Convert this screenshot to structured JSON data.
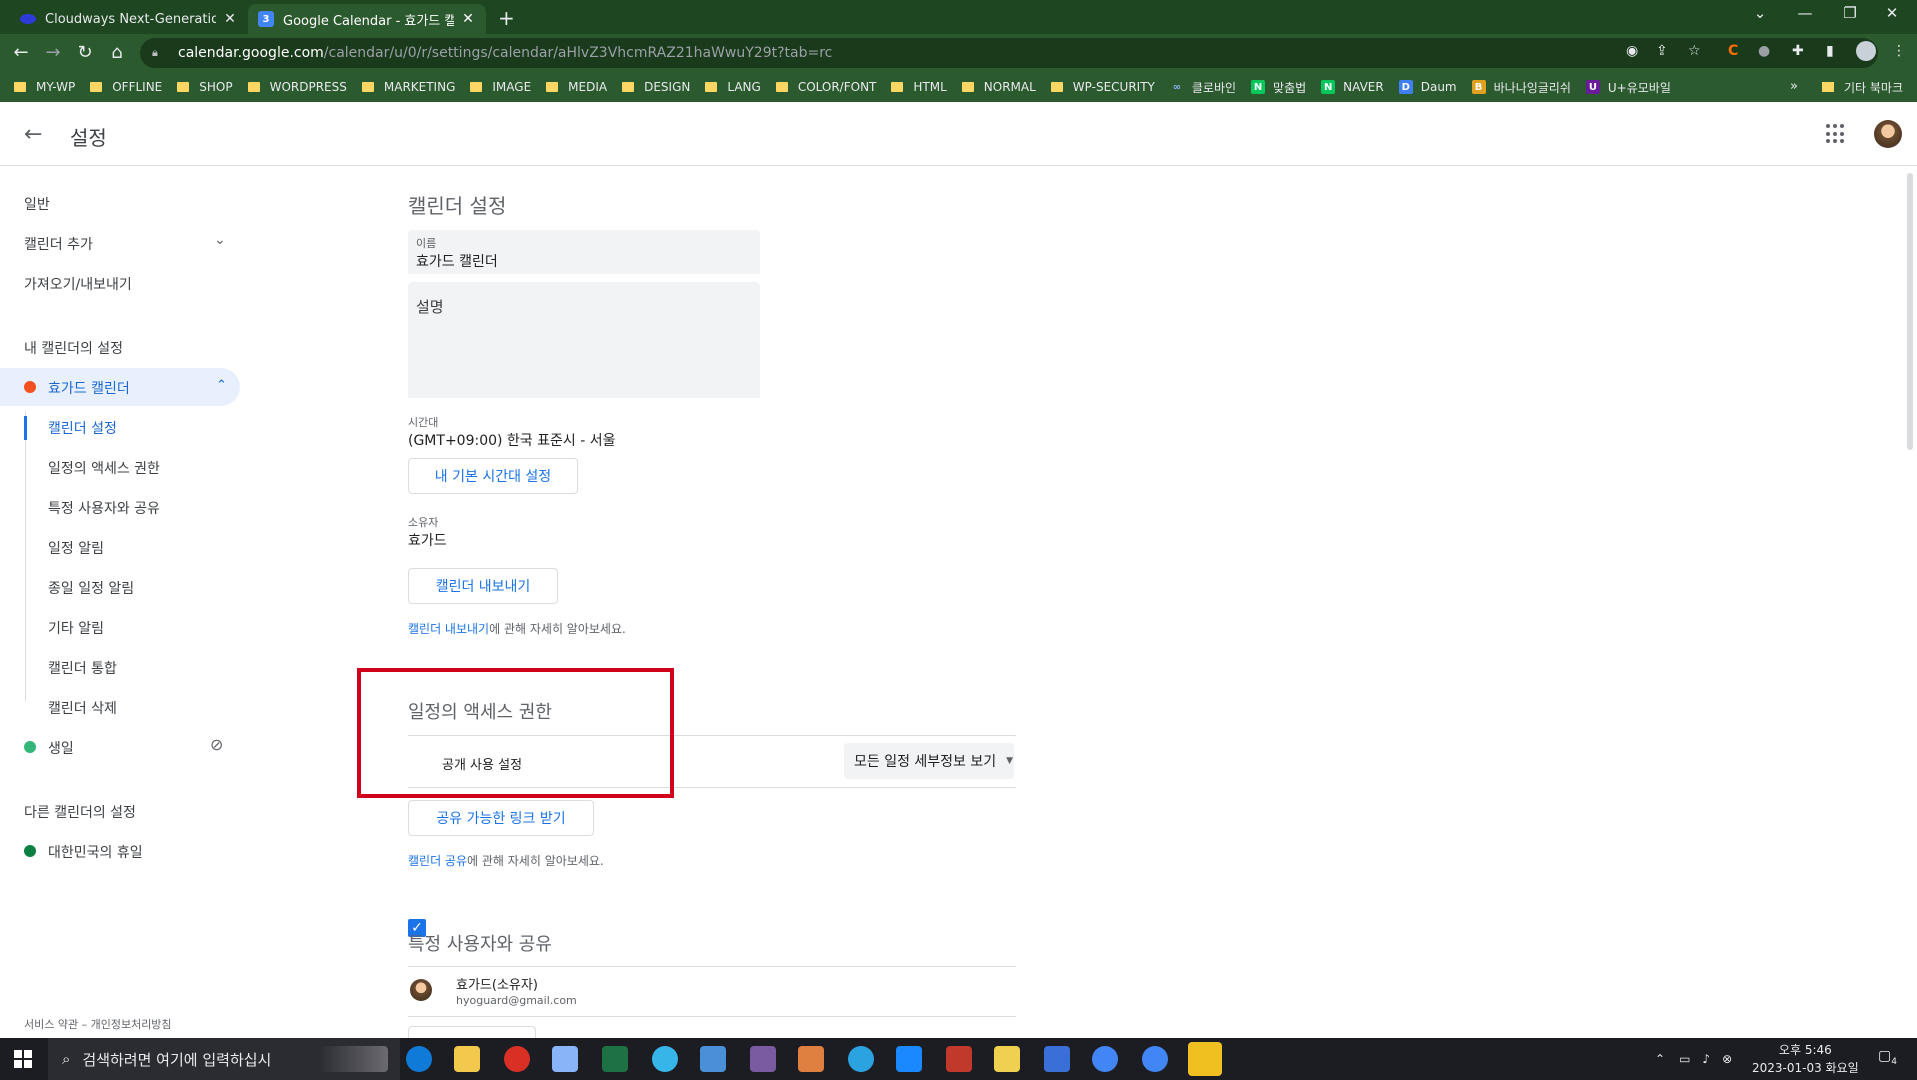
{
  "browser": {
    "tabs": [
      {
        "label": "Cloudways Next-Generation Clo",
        "favicon_color": "#2d3bd8"
      },
      {
        "label": "Google Calendar - 효가드 캘린더",
        "favicon_color": "#4285f4",
        "favicon_text": "3"
      }
    ],
    "url_host": "calendar.google.com",
    "url_path": "/calendar/u/0/r/settings/calendar/aHlvZ3VhcmRAZ21haWwuY29t?tab=rc",
    "bookmarks": [
      {
        "label": "MY-WP",
        "type": "folder"
      },
      {
        "label": "OFFLINE",
        "type": "folder"
      },
      {
        "label": "SHOP",
        "type": "folder"
      },
      {
        "label": "WORDPRESS",
        "type": "folder"
      },
      {
        "label": "MARKETING",
        "type": "folder"
      },
      {
        "label": "IMAGE",
        "type": "folder"
      },
      {
        "label": "MEDIA",
        "type": "folder"
      },
      {
        "label": "DESIGN",
        "type": "folder"
      },
      {
        "label": "LANG",
        "type": "folder"
      },
      {
        "label": "COLOR/FONT",
        "type": "folder"
      },
      {
        "label": "HTML",
        "type": "folder"
      },
      {
        "label": "NORMAL",
        "type": "folder"
      },
      {
        "label": "WP-SECURITY",
        "type": "folder"
      },
      {
        "label": "클로바인",
        "type": "site",
        "icon_text": "∞",
        "color": "#2c5a2f"
      },
      {
        "label": "맞춤법",
        "type": "site",
        "icon_text": "N",
        "color": "#03c75a"
      },
      {
        "label": "NAVER",
        "type": "site",
        "icon_text": "N",
        "color": "#03c75a"
      },
      {
        "label": "Daum",
        "type": "site",
        "icon_text": "D",
        "color": "#3f7ef3"
      },
      {
        "label": "바나나잉글리쉬",
        "type": "site",
        "icon_text": "B",
        "color": "#e0a020"
      },
      {
        "label": "U+유모바일",
        "type": "site",
        "icon_text": "U",
        "color": "#6a1b9a"
      }
    ],
    "bookmarks_more": "»",
    "other_bookmarks": "기타 북마크"
  },
  "header": {
    "title": "설정"
  },
  "sidebar": {
    "general": "일반",
    "add_calendar": "캘린더 추가",
    "import_export": "가져오기/내보내기",
    "my_calendars_heading": "내 캘린더의 설정",
    "active_calendar": "효가드 캘린더",
    "active_calendar_color": "#f4511e",
    "sub_items": [
      "캘린더 설정",
      "일정의 액세스 권한",
      "특정 사용자와 공유",
      "일정 알림",
      "종일 일정 알림",
      "기타 알림",
      "캘린더 통합",
      "캘린더 삭제"
    ],
    "birthday_calendar": "생일",
    "birthday_color": "#33b679",
    "other_calendars_heading": "다른 캘린더의 설정",
    "holiday_calendar": "대한민국의 휴일",
    "holiday_color": "#0b8043",
    "footer": "서비스 약관 – 개인정보처리방침"
  },
  "main": {
    "calendar_settings_title": "캘린더 설정",
    "name_label": "이름",
    "name_value": "효가드 캘린더",
    "description_placeholder": "설명",
    "timezone_label": "시간대",
    "timezone_value": "(GMT+09:00) 한국 표준시 - 서울",
    "timezone_button": "내 기본 시간대 설정",
    "owner_label": "소유자",
    "owner_value": "효가드",
    "export_button": "캘린더 내보내기",
    "export_help_link": "캘린더 내보내기",
    "export_help_rest": "에 관해 자세히 알아보세요.",
    "access_title": "일정의 액세스 권한",
    "public_checkbox_label": "공개 사용 설정",
    "public_checked": true,
    "visibility_option": "모든 일정 세부정보 보기",
    "share_link_button": "공유 가능한 링크 받기",
    "share_help_link": "캘린더 공유",
    "share_help_rest": "에 관해 자세히 알아보세요.",
    "share_users_title": "특정 사용자와 공유",
    "owner_entry_name": "효가드(소유자)",
    "owner_entry_email": "hyoguard@gmail.com"
  },
  "taskbar": {
    "search_placeholder": "검색하려면 여기에 입력하십시",
    "time": "오후 5:46",
    "date": "2023-01-03 화요일",
    "notification_count": "4"
  }
}
